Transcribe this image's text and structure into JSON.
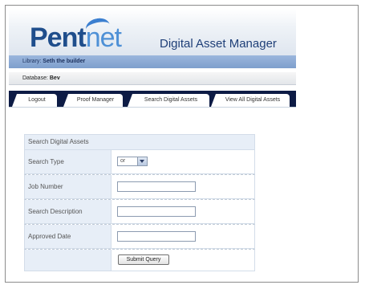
{
  "header": {
    "logo_part1": "Pent",
    "logo_part2": "net",
    "app_title": "Digital Asset Manager"
  },
  "library_bar": {
    "label": "Library:",
    "value": "Seth the builder"
  },
  "database_bar": {
    "label": "Database:",
    "value": "Bev"
  },
  "nav": {
    "tabs": [
      "Logout",
      "Proof Manager",
      "Search Digital Assets",
      "View All Digital Assets"
    ]
  },
  "form": {
    "title": "Search Digital Assets",
    "search_type_label": "Search Type",
    "search_type_value": "or",
    "job_number_label": "Job Number",
    "job_number_value": "",
    "search_description_label": "Search Description",
    "search_description_value": "",
    "approved_date_label": "Approved Date",
    "approved_date_value": "",
    "submit_label": "Submit Query"
  },
  "colors": {
    "navbar": "#0d1b45",
    "library_bar": "#8aa8d4",
    "form_label_bg": "#e7eef7"
  }
}
